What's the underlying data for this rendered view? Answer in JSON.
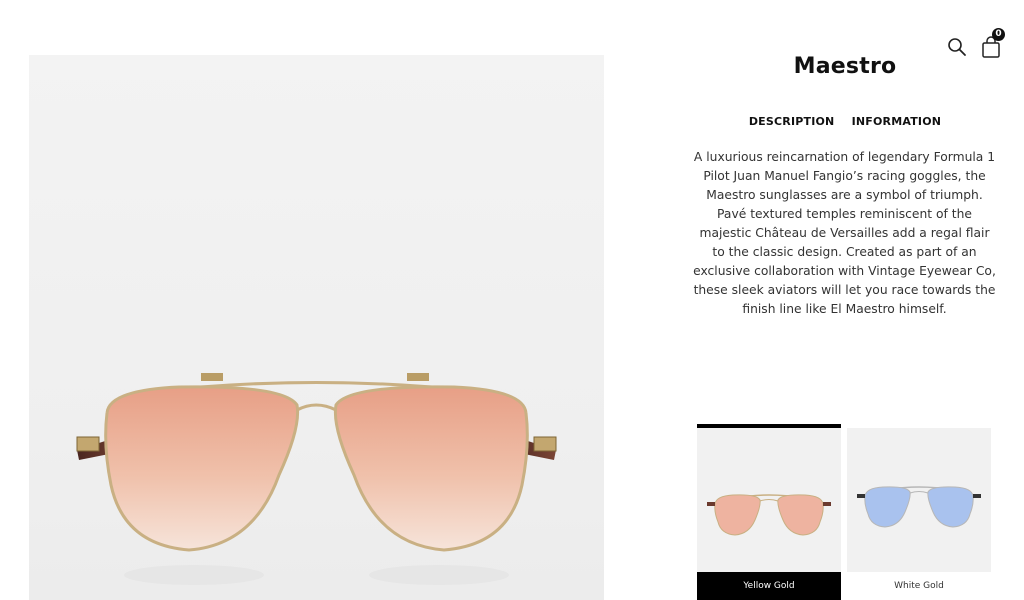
{
  "product": {
    "title": "Maestro",
    "description": "A luxurious reincarnation of legendary Formula 1 Pilot Juan Manuel Fangio’s racing goggles, the Maestro sunglasses are a symbol of triumph. Pavé textured temples reminiscent of the majestic Château de Versailles add a regal flair to the classic design. Created as part of an exclusive collaboration with Vintage Eyewear Co, these sleek aviators will let you race towards the finish line like El Maestro himself."
  },
  "tabs": [
    {
      "label": "DESCRIPTION"
    },
    {
      "label": "INFORMATION"
    }
  ],
  "header": {
    "search_icon": "search-icon",
    "cart_icon": "shopping-bag-icon",
    "cart_count": "0"
  },
  "variants": [
    {
      "label": "Yellow Gold",
      "lens_color": "#e9a58f",
      "selected": true
    },
    {
      "label": "White Gold",
      "lens_color": "#9fb8e6",
      "selected": false
    }
  ],
  "colors": {
    "lens_rose": "#e9a58f",
    "frame_gold": "#c9b083",
    "temple_brown": "#6b3a2e",
    "lens_blue": "#9fb8e6"
  }
}
